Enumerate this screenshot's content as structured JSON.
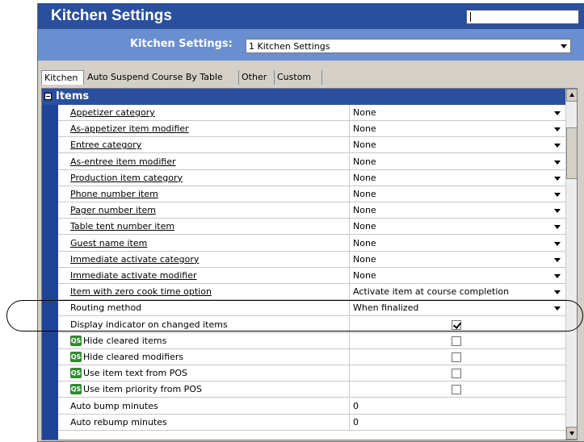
{
  "window": {
    "title": "Kitchen Settings"
  },
  "selector": {
    "label": "Kitchen Settings:",
    "value": "1 Kitchen Settings"
  },
  "tabs": [
    {
      "label": "Kitchen"
    },
    {
      "label": "Auto Suspend Course By Table"
    },
    {
      "label": "Other"
    },
    {
      "label": "Custom"
    }
  ],
  "group": {
    "label": "Items",
    "toggle": "collapse"
  },
  "rows": [
    {
      "label": "Appetizer category",
      "value": "None",
      "type": "dropdown"
    },
    {
      "label": "As-appetizer item modifier",
      "value": "None",
      "type": "dropdown"
    },
    {
      "label": "Entree category",
      "value": "None",
      "type": "dropdown"
    },
    {
      "label": "As-entree item modifier",
      "value": "None",
      "type": "dropdown"
    },
    {
      "label": "Production item category",
      "value": "None",
      "type": "dropdown"
    },
    {
      "label": "Phone number item",
      "value": "None",
      "type": "dropdown"
    },
    {
      "label": "Pager number item",
      "value": "None",
      "type": "dropdown"
    },
    {
      "label": "Table tent number item",
      "value": "None",
      "type": "dropdown"
    },
    {
      "label": "Guest name item",
      "value": "None",
      "type": "dropdown"
    },
    {
      "label": "Immediate activate category",
      "value": "None",
      "type": "dropdown"
    },
    {
      "label": "Immediate activate modifier",
      "value": "None",
      "type": "dropdown"
    },
    {
      "label": "Item with zero cook time option",
      "value": "Activate item at course completion",
      "type": "dropdown"
    },
    {
      "label": "Routing method",
      "value": "When finalized",
      "type": "dropdown"
    },
    {
      "label": "Display indicator on changed items",
      "checked": true,
      "type": "checkbox"
    },
    {
      "label": "Hide cleared items",
      "checked": false,
      "type": "checkbox",
      "qs": true
    },
    {
      "label": "Hide cleared modifiers",
      "checked": false,
      "type": "checkbox",
      "qs": true
    },
    {
      "label": "Use item text from POS",
      "checked": false,
      "type": "checkbox",
      "qs": true
    },
    {
      "label": "Use item priority from POS",
      "checked": false,
      "type": "checkbox",
      "qs": true
    },
    {
      "label": "Auto bump minutes",
      "value": "0",
      "type": "text"
    },
    {
      "label": "Auto rebump minutes",
      "value": "0",
      "type": "text"
    }
  ],
  "qs_badge": "QS",
  "colors": {
    "titlebar": "#2a4f9d",
    "subbar": "#6a8fd0",
    "gutter": "#1e4497"
  }
}
